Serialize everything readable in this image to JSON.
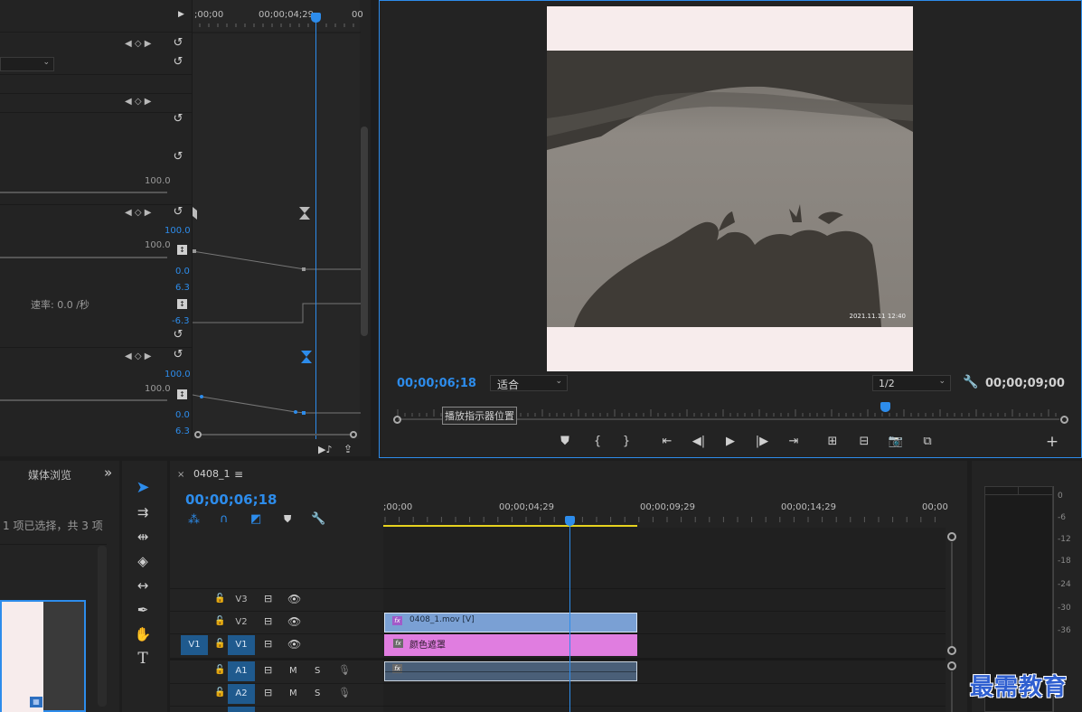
{
  "effect_controls": {
    "ruler": {
      "t0": ";00;00",
      "t1": "00;00;04;29",
      "t2": "00"
    },
    "value_100_a": "100.0",
    "opacity_max": "100.0",
    "opacity_val": "100.0",
    "opacity_min": "0.0",
    "velocity_max": "6.3",
    "velocity_min": "-6.3",
    "rate_label": "速率: 0.0 /秒",
    "scale_max": "100.0",
    "scale_val": "100.0",
    "scale_min": "0.0",
    "scale_vel": "6.3"
  },
  "program_monitor": {
    "current_timecode": "00;00;06;18",
    "fit_select": "适合",
    "resolution_select": "1/2",
    "duration": "00;00;09;00",
    "tooltip": "播放指示器位置",
    "image_stamp": "2021.11.11 12:40"
  },
  "project_panel": {
    "tab_label": "媒体浏览",
    "more": "»",
    "selection_status": "1 项已选择，共 3 项"
  },
  "timeline": {
    "tab_close": "×",
    "sequence_name": "0408_1",
    "menu": "≡",
    "current_timecode": "00;00;06;18",
    "ruler": [
      ";00;00",
      "00;00;04;29",
      "00;00;09;29",
      "00;00;14;29",
      "00;00"
    ],
    "tracks": {
      "v3": "V3",
      "v2": "V2",
      "v1": "V1",
      "src_v1": "V1",
      "a1": "A1",
      "a2": "A2",
      "m": "M",
      "s": "S"
    },
    "clip_v2": "0408_1.mov [V]",
    "clip_v1": "颜色遮罩",
    "fx": "fx"
  },
  "audio_meter": {
    "labels": [
      "0",
      "-6",
      "-12",
      "-18",
      "-24",
      "-30",
      "-36"
    ]
  },
  "watermark": "最需教育",
  "colors": {
    "accent_blue": "#2d8ceb",
    "clip_video": "#7aa0d4",
    "clip_matte": "#e07de0",
    "audio_clip": "#4a5f78",
    "work_area": "#e6d21e"
  }
}
